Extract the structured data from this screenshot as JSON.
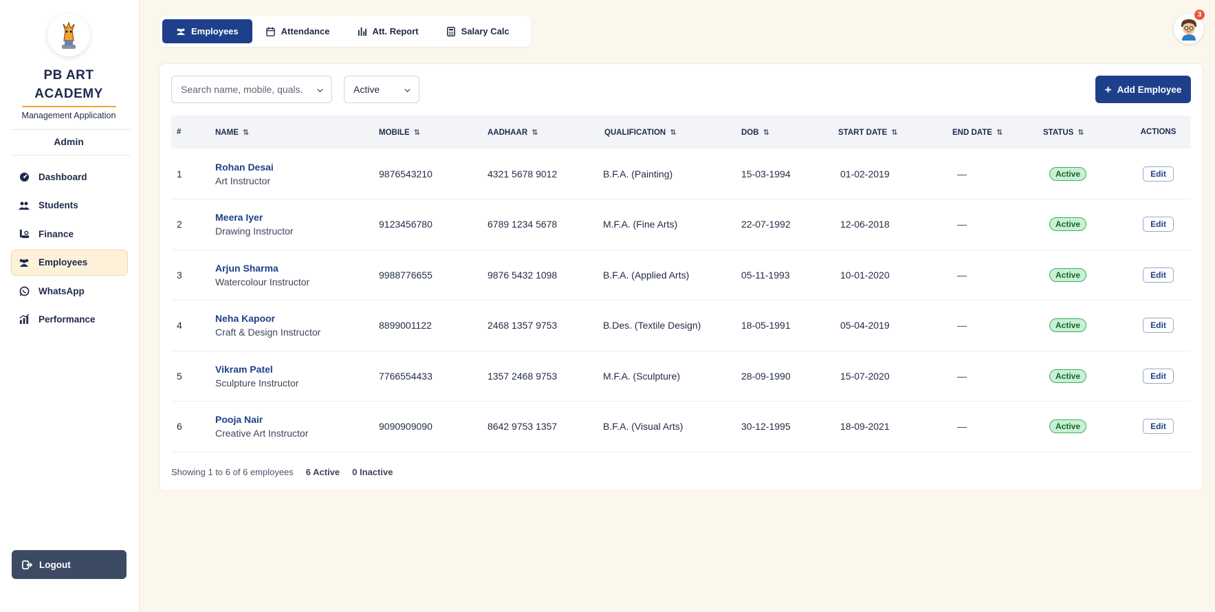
{
  "sidebar": {
    "brand_line1": "PB ART",
    "brand_line2": "ACADEMY",
    "subtitle": "Management Application",
    "role": "Admin",
    "items": [
      {
        "label": "Dashboard",
        "icon": "dashboard-icon"
      },
      {
        "label": "Students",
        "icon": "students-icon"
      },
      {
        "label": "Finance",
        "icon": "finance-icon"
      },
      {
        "label": "Employees",
        "icon": "employees-icon",
        "active": true
      },
      {
        "label": "WhatsApp",
        "icon": "whatsapp-icon"
      },
      {
        "label": "Performance",
        "icon": "performance-icon"
      }
    ],
    "logout": "Logout"
  },
  "tabs": [
    {
      "label": "Employees",
      "icon": "users-icon",
      "active": true
    },
    {
      "label": "Attendance",
      "icon": "calendar-icon"
    },
    {
      "label": "Att. Report",
      "icon": "bar-chart-icon"
    },
    {
      "label": "Salary Calc",
      "icon": "calculator-icon"
    }
  ],
  "header": {
    "notification_count": "3"
  },
  "toolbar": {
    "search_placeholder": "Search name, mobile, quals.",
    "status_filter": "Active",
    "add_label": "Add Employee"
  },
  "table": {
    "columns": [
      "#",
      "NAME",
      "MOBILE",
      "AADHAAR",
      "QUALIFICATION",
      "DOB",
      "START DATE",
      "END DATE",
      "STATUS",
      "ACTIONS"
    ],
    "rows": [
      {
        "num": "1",
        "name": "Rohan Desai",
        "role": "Art Instructor",
        "mobile": "9876543210",
        "aadhaar": "4321 5678 9012",
        "qualification": "B.F.A. (Painting)",
        "dob": "15-03-1994",
        "start": "01-02-2019",
        "end": "—",
        "status": "Active",
        "action": "Edit"
      },
      {
        "num": "2",
        "name": "Meera Iyer",
        "role": "Drawing Instructor",
        "mobile": "9123456780",
        "aadhaar": "6789 1234 5678",
        "qualification": "M.F.A. (Fine Arts)",
        "dob": "22-07-1992",
        "start": "12-06-2018",
        "end": "—",
        "status": "Active",
        "action": "Edit"
      },
      {
        "num": "3",
        "name": "Arjun Sharma",
        "role": "Watercolour Instructor",
        "mobile": "9988776655",
        "aadhaar": "9876 5432 1098",
        "qualification": "B.F.A. (Applied Arts)",
        "dob": "05-11-1993",
        "start": "10-01-2020",
        "end": "—",
        "status": "Active",
        "action": "Edit"
      },
      {
        "num": "4",
        "name": "Neha Kapoor",
        "role": "Craft & Design Instructor",
        "mobile": "8899001122",
        "aadhaar": "2468 1357 9753",
        "qualification": "B.Des. (Textile Design)",
        "dob": "18-05-1991",
        "start": "05-04-2019",
        "end": "—",
        "status": "Active",
        "action": "Edit"
      },
      {
        "num": "5",
        "name": "Vikram Patel",
        "role": "Sculpture Instructor",
        "mobile": "7766554433",
        "aadhaar": "1357 2468 9753",
        "qualification": "M.F.A. (Sculpture)",
        "dob": "28-09-1990",
        "start": "15-07-2020",
        "end": "—",
        "status": "Active",
        "action": "Edit"
      },
      {
        "num": "6",
        "name": "Pooja Nair",
        "role": "Creative Art Instructor",
        "mobile": "9090909090",
        "aadhaar": "8642 9753 1357",
        "qualification": "B.F.A. (Visual Arts)",
        "dob": "30-12-1995",
        "start": "18-09-2021",
        "end": "—",
        "status": "Active",
        "action": "Edit"
      }
    ]
  },
  "footer": {
    "showing": "Showing 1 to 6 of 6 employees",
    "active": "6 Active",
    "inactive": "0 Inactive"
  },
  "colors": {
    "primary": "#1e3f8a",
    "accent": "#f0a434",
    "background": "#fcf7ec",
    "active_badge": "#c8f0d3"
  }
}
